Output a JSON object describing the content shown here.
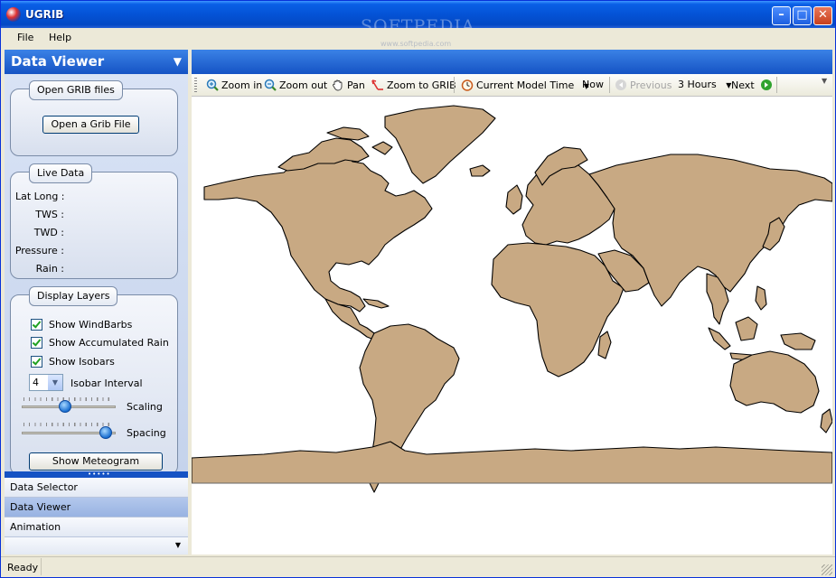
{
  "window": {
    "title": "UGRIB",
    "watermark": "SOFTPEDIA",
    "watermark_sub": "www.softpedia.com"
  },
  "menu": {
    "file": "File",
    "help": "Help"
  },
  "panel": {
    "title": "Data Viewer"
  },
  "open_group": {
    "title": "Open GRIB files",
    "button": "Open a Grib File"
  },
  "live_group": {
    "title": "Live Data",
    "fields": [
      {
        "label": "Lat Long :"
      },
      {
        "label": "TWS :"
      },
      {
        "label": "TWD :"
      },
      {
        "label": "Pressure :"
      },
      {
        "label": "Rain :"
      }
    ]
  },
  "layers_group": {
    "title": "Display Layers",
    "checkboxes": [
      {
        "label": "Show WindBarbs",
        "checked": true
      },
      {
        "label": "Show Accumulated Rain",
        "checked": true
      },
      {
        "label": "Show Isobars",
        "checked": true
      }
    ],
    "isobar": {
      "value": "4",
      "label": "Isobar Interval"
    },
    "scaling": {
      "label": "Scaling",
      "value": 0.45
    },
    "spacing": {
      "label": "Spacing",
      "value": 0.95
    },
    "meteogram_button": "Show Meteogram"
  },
  "nav": {
    "items": [
      {
        "label": "Data Selector",
        "active": false
      },
      {
        "label": "Data Viewer",
        "active": true
      },
      {
        "label": "Animation",
        "active": false
      }
    ]
  },
  "toolbar": {
    "zoom_in": "Zoom in",
    "zoom_out": "Zoom out",
    "pan": "Pan",
    "zoom_grib": "Zoom to GRIB",
    "time_mode": "Current Model Time",
    "now": "Now",
    "previous": "Previous",
    "step": "3 Hours",
    "next": "Next"
  },
  "map": {
    "land_color": "#c8a983",
    "ocean_color": "#ffffff",
    "coast_color": "#000000"
  },
  "status": {
    "text": "Ready"
  }
}
